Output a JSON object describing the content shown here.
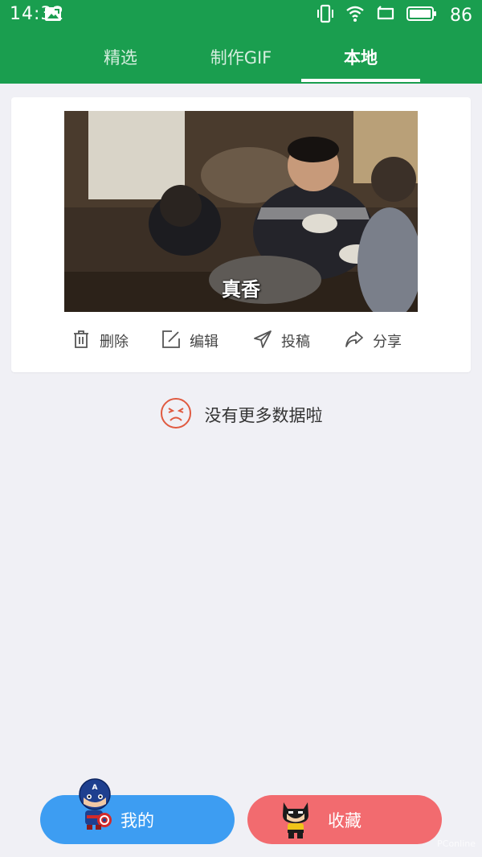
{
  "status_bar": {
    "time": "14:32",
    "battery": "86",
    "icons": [
      "image-notification-icon",
      "vibrate-icon",
      "wifi-icon",
      "screen-rotation-icon",
      "battery-icon"
    ]
  },
  "tabs": [
    {
      "label": "精选",
      "active": false
    },
    {
      "label": "制作GIF",
      "active": false
    },
    {
      "label": "本地",
      "active": true
    }
  ],
  "card": {
    "gif_caption": "真香",
    "actions": [
      {
        "label": "删除",
        "icon": "trash-icon"
      },
      {
        "label": "编辑",
        "icon": "edit-icon"
      },
      {
        "label": "投稿",
        "icon": "send-icon"
      },
      {
        "label": "分享",
        "icon": "share-icon"
      }
    ]
  },
  "empty_message": "没有更多数据啦",
  "bottom": {
    "mine_label": "我的",
    "fav_label": "收藏"
  },
  "watermark": "PConline",
  "colors": {
    "header": "#1a9e4f",
    "mine_button": "#3d9df2",
    "fav_button": "#f26b6f",
    "empty_icon": "#e05a40",
    "background": "#f0f0f5"
  }
}
